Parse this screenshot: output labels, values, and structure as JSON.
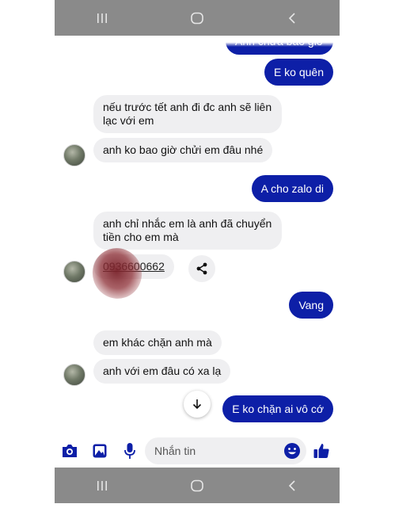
{
  "messages": [
    {
      "dir": "out",
      "text": "Anh chưa bao giờ"
    },
    {
      "dir": "out",
      "text": "E ko quên"
    },
    {
      "dir": "in",
      "text": "nếu trước tết anh đi đc anh sẽ liên lạc với em"
    },
    {
      "dir": "in",
      "text": "anh ko bao giờ chửi em đâu nhé"
    },
    {
      "dir": "out",
      "text": "A cho zalo di"
    },
    {
      "dir": "in",
      "text": "anh chỉ nhắc em là anh đã chuyển tiền cho em mà"
    },
    {
      "dir": "in",
      "text": "0936600662"
    },
    {
      "dir": "out",
      "text": "Vang"
    },
    {
      "dir": "in",
      "text": "em khác chặn anh mà"
    },
    {
      "dir": "in",
      "text": "anh với em đâu có xa lạ"
    },
    {
      "dir": "out",
      "text": "E ko chặn ai vô cớ"
    }
  ],
  "composer": {
    "placeholder": "Nhắn tin"
  },
  "icons": {
    "share": "share-icon",
    "scroll": "arrow-down-icon",
    "camera": "camera-icon",
    "gallery": "image-icon",
    "mic": "microphone-icon",
    "emoji": "emoji-icon",
    "like": "thumbs-up-icon",
    "nav_recent": "recent-apps-icon",
    "nav_home": "home-icon",
    "nav_back": "back-icon"
  },
  "colors": {
    "accent": "#0d1fa7",
    "incoming_bubble": "#efeff1",
    "nav_bar": "#8a8a8a"
  }
}
